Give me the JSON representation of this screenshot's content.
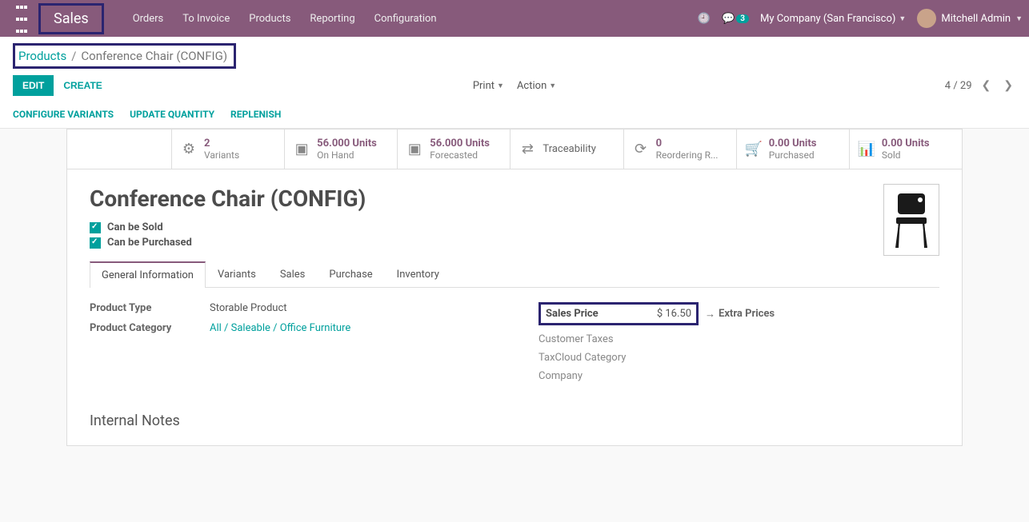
{
  "topbar": {
    "brand": "Sales",
    "nav": {
      "orders": "Orders",
      "to_invoice": "To Invoice",
      "products": "Products",
      "reporting": "Reporting",
      "configuration": "Configuration"
    },
    "chat_count": "3",
    "company": "My Company (San Francisco)",
    "user": "Mitchell Admin"
  },
  "breadcrumb": {
    "root": "Products",
    "current": "Conference Chair (CONFIG)"
  },
  "controls": {
    "edit": "EDIT",
    "create": "CREATE",
    "print": "Print",
    "action": "Action",
    "pager": "4 / 29"
  },
  "secondary": {
    "configure_variants": "CONFIGURE VARIANTS",
    "update_qty": "UPDATE QUANTITY",
    "replenish": "REPLENISH"
  },
  "stats": {
    "variants_num": "2",
    "variants_lbl": "Variants",
    "onhand_num": "56.000 Units",
    "onhand_lbl": "On Hand",
    "forecast_num": "56.000 Units",
    "forecast_lbl": "Forecasted",
    "trace_lbl": "Traceability",
    "reorder_num": "0",
    "reorder_lbl": "Reordering R...",
    "purchased_num": "0.00 Units",
    "purchased_lbl": "Purchased",
    "sold_num": "0.00 Units",
    "sold_lbl": "Sold"
  },
  "product": {
    "name": "Conference Chair (CONFIG)",
    "can_sold": "Can be Sold",
    "can_purchased": "Can be Purchased"
  },
  "tabs": {
    "general": "General Information",
    "variants": "Variants",
    "sales": "Sales",
    "purchase": "Purchase",
    "inventory": "Inventory"
  },
  "fields": {
    "product_type_label": "Product Type",
    "product_type_value": "Storable Product",
    "product_category_label": "Product Category",
    "product_category_value": "All / Saleable / Office Furniture",
    "sales_price_label": "Sales Price",
    "sales_price_value": "$ 16.50",
    "extra_prices": "Extra Prices",
    "customer_taxes": "Customer Taxes",
    "taxcloud": "TaxCloud Category",
    "company": "Company"
  },
  "internal_notes": "Internal Notes"
}
